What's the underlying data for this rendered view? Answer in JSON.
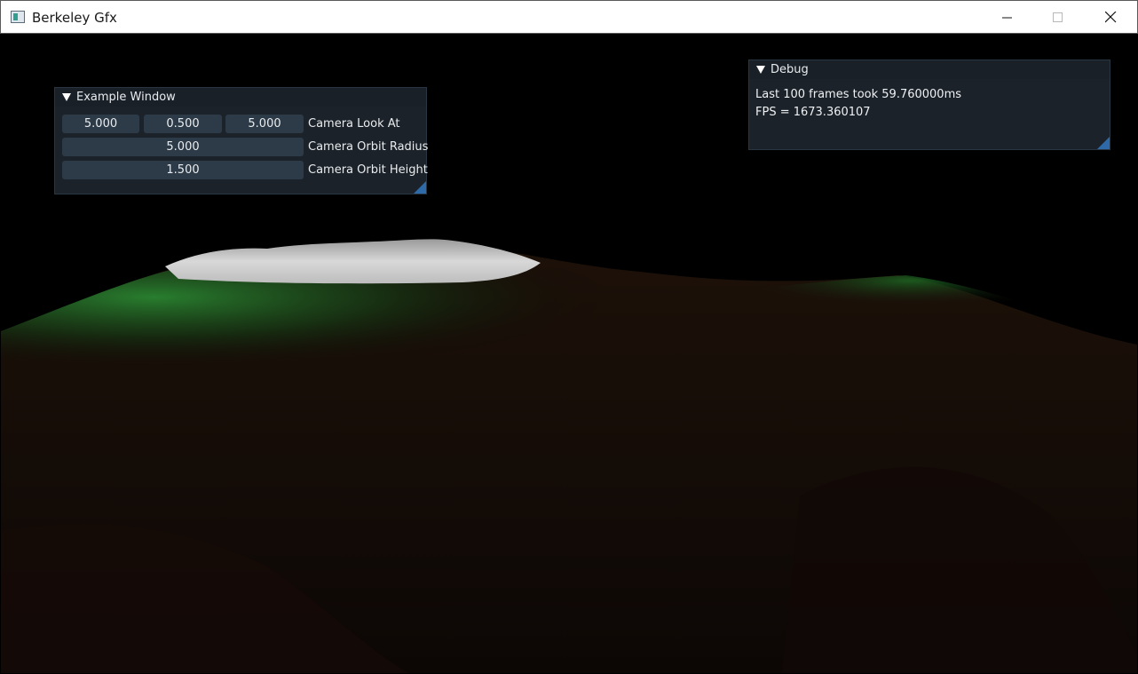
{
  "window": {
    "title": "Berkeley Gfx",
    "controls": [
      "minimize-icon",
      "maximize-icon",
      "close-icon"
    ]
  },
  "example_window": {
    "title": "Example Window",
    "camera_look_at": {
      "label": "Camera Look At",
      "values": [
        "5.000",
        "0.500",
        "5.000"
      ]
    },
    "camera_orbit_radius": {
      "label": "Camera Orbit Radius",
      "value": "5.000"
    },
    "camera_orbit_height": {
      "label": "Camera Orbit Height",
      "value": "1.500"
    }
  },
  "debug_window": {
    "title": "Debug",
    "frame_time_text": "Last 100 frames took 59.760000ms",
    "fps_text": "FPS = 1673.360107"
  },
  "colors": {
    "panel_bg": "#1e252c",
    "header_bg": "#192028",
    "field_bg": "#2d3a47",
    "grip": "#2e6aa8",
    "terrain_green": "#1f7a2a",
    "terrain_snow": "#cfcfcf"
  }
}
